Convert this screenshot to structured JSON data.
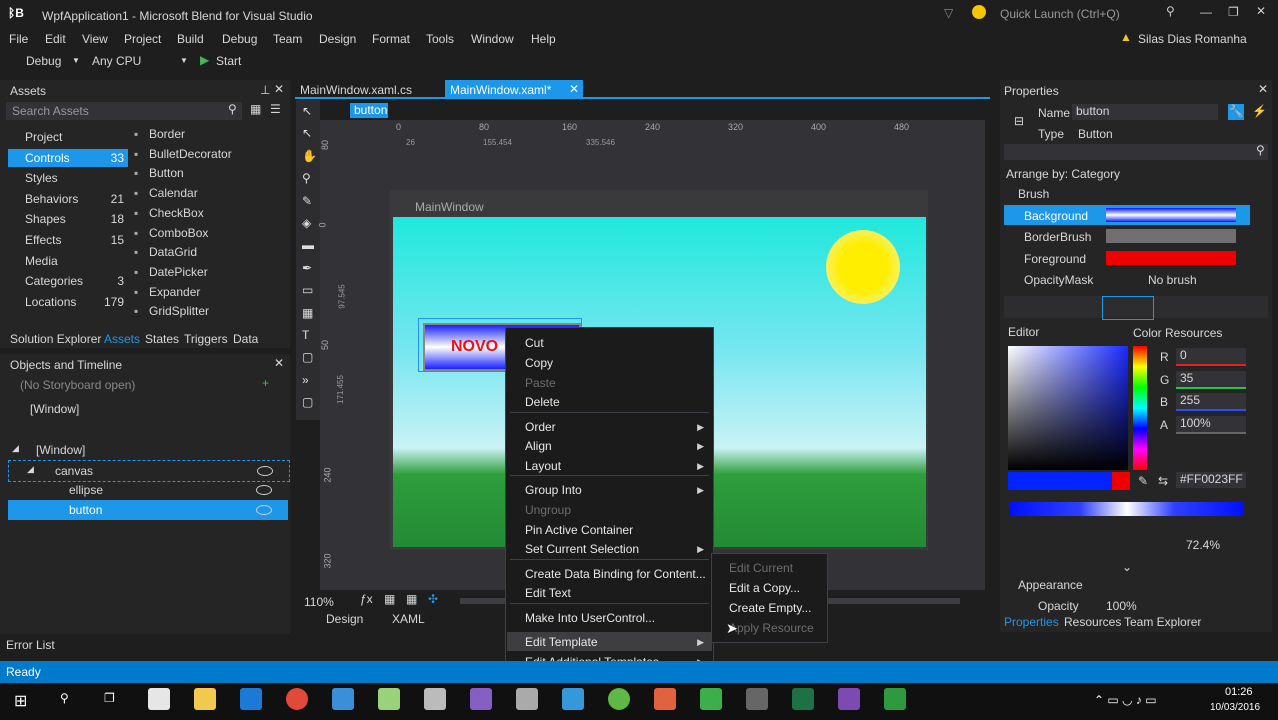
{
  "window": {
    "title": "WpfApplication1 - Microsoft Blend for Visual Studio",
    "quick_launch": "Quick Launch (Ctrl+Q)",
    "user": "Silas Dias Romanha"
  },
  "menu": [
    "File",
    "Edit",
    "View",
    "Project",
    "Build",
    "Debug",
    "Team",
    "Design",
    "Format",
    "Tools",
    "Window",
    "Help"
  ],
  "toolbar": {
    "config": "Debug",
    "platform": "Any CPU",
    "start": "Start"
  },
  "assets": {
    "title": "Assets",
    "search_placeholder": "Search Assets",
    "categories": [
      {
        "label": "Project",
        "count": ""
      },
      {
        "label": "Controls",
        "count": "33"
      },
      {
        "label": "Styles",
        "count": ""
      },
      {
        "label": "Behaviors",
        "count": "21"
      },
      {
        "label": "Shapes",
        "count": "18"
      },
      {
        "label": "Effects",
        "count": "15"
      },
      {
        "label": "Media",
        "count": ""
      },
      {
        "label": "Categories",
        "count": "3"
      },
      {
        "label": "Locations",
        "count": "179"
      }
    ],
    "items": [
      "Border",
      "BulletDecorator",
      "Button",
      "Calendar",
      "CheckBox",
      "ComboBox",
      "DataGrid",
      "DatePicker",
      "Expander",
      "GridSplitter"
    ],
    "tabs": [
      "Solution Explorer",
      "Assets",
      "States",
      "Triggers",
      "Data"
    ]
  },
  "objects": {
    "title": "Objects and Timeline",
    "storyboard": "(No Storyboard open)",
    "root": "[Window]",
    "tree": [
      "[Window]",
      "canvas",
      "ellipse",
      "button"
    ]
  },
  "editor": {
    "tabs": [
      "MainWindow.xaml.cs",
      "MainWindow.xaml*"
    ],
    "breadcrumb": "button",
    "ruler_top": [
      "0",
      "80",
      "160",
      "240",
      "320",
      "400",
      "480"
    ],
    "ruler_left": [
      "80",
      "0",
      "50",
      "240",
      "320"
    ],
    "dims": {
      "a": "26",
      "b": "155.454",
      "c": "335.546",
      "d": "97.545",
      "e": "171.455"
    },
    "window_title": "MainWindow",
    "button_text": "NOVO",
    "zoom": "110%",
    "view_tabs": [
      "Design",
      "XAML"
    ]
  },
  "context_menu": {
    "items": [
      {
        "label": "Cut",
        "disabled": false,
        "sub": false
      },
      {
        "label": "Copy",
        "disabled": false,
        "sub": false
      },
      {
        "label": "Paste",
        "disabled": true,
        "sub": false
      },
      {
        "label": "Delete",
        "disabled": false,
        "sub": false
      },
      {
        "label": "Order",
        "disabled": false,
        "sub": true
      },
      {
        "label": "Align",
        "disabled": false,
        "sub": true
      },
      {
        "label": "Layout",
        "disabled": false,
        "sub": true
      },
      {
        "label": "Group Into",
        "disabled": false,
        "sub": true
      },
      {
        "label": "Ungroup",
        "disabled": true,
        "sub": false
      },
      {
        "label": "Pin Active Container",
        "disabled": false,
        "sub": false
      },
      {
        "label": "Set Current Selection",
        "disabled": false,
        "sub": true
      },
      {
        "label": "Create Data Binding for Content...",
        "disabled": false,
        "sub": false
      },
      {
        "label": "Edit Text",
        "disabled": false,
        "sub": false
      },
      {
        "label": "Make Into UserControl...",
        "disabled": false,
        "sub": false
      },
      {
        "label": "Edit Template",
        "disabled": false,
        "sub": true
      },
      {
        "label": "Edit Additional Templates",
        "disabled": false,
        "sub": true
      }
    ],
    "submenu": [
      {
        "label": "Edit Current",
        "disabled": true
      },
      {
        "label": "Edit a Copy...",
        "disabled": false
      },
      {
        "label": "Create Empty...",
        "disabled": false
      },
      {
        "label": "Apply Resource",
        "disabled": true
      }
    ]
  },
  "properties": {
    "title": "Properties",
    "name_label": "Name",
    "name_value": "button",
    "type_label": "Type",
    "type_value": "Button",
    "arrange": "Arrange by: Category",
    "brush_section": "Brush",
    "brushes": [
      {
        "label": "Background",
        "value": ""
      },
      {
        "label": "BorderBrush",
        "value": ""
      },
      {
        "label": "Foreground",
        "value": ""
      },
      {
        "label": "OpacityMask",
        "value": "No brush"
      }
    ],
    "editor_label": "Editor",
    "color_resources": "Color Resources",
    "rgba": [
      {
        "k": "R",
        "v": "0"
      },
      {
        "k": "G",
        "v": "35"
      },
      {
        "k": "B",
        "v": "255"
      },
      {
        "k": "A",
        "v": "100%"
      }
    ],
    "hex": "#FF0023FF",
    "gradient_pct": "72.4%",
    "appearance": "Appearance",
    "opacity_label": "Opacity",
    "opacity_value": "100%",
    "bottom_tabs": [
      "Properties",
      "Resources",
      "Team Explorer"
    ]
  },
  "status": {
    "error_list": "Error List",
    "ready": "Ready"
  },
  "taskbar": {
    "time": "01:26",
    "date": "10/03/2016"
  },
  "colors": {
    "accent": "#1c97ea",
    "status_bar": "#007acc"
  }
}
